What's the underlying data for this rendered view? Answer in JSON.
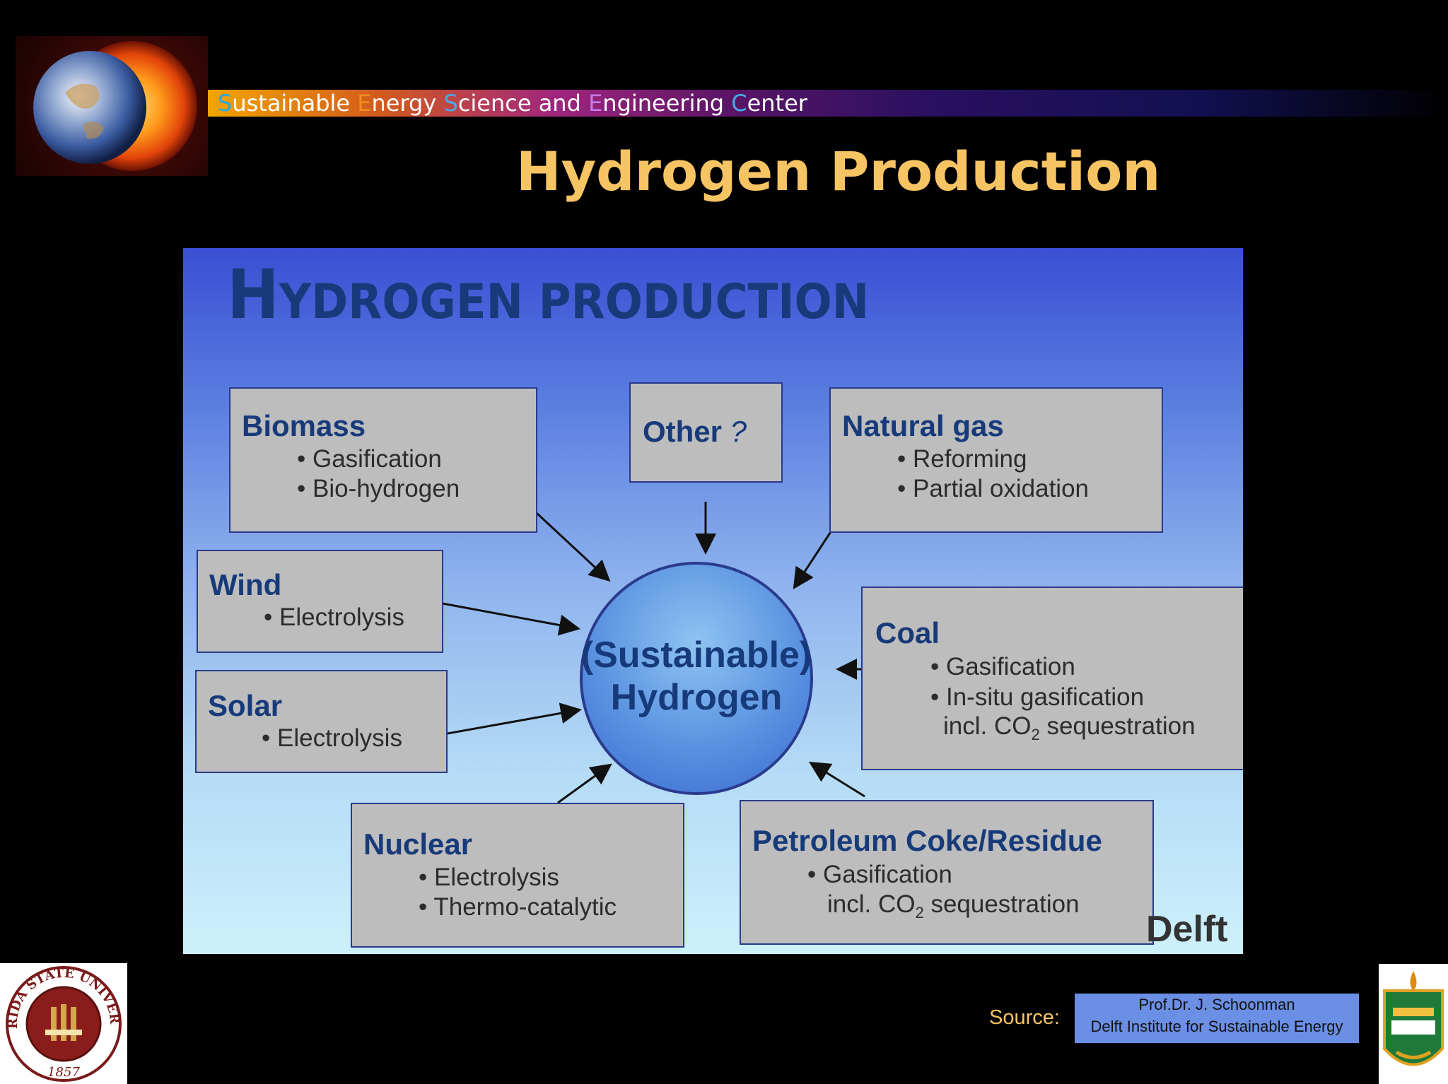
{
  "header": {
    "center_name_parts": [
      {
        "initial": "S",
        "rest": "ustainable ",
        "color": "#27a8e0"
      },
      {
        "initial": "E",
        "rest": "nergy ",
        "color": "#f28c20"
      },
      {
        "initial": "S",
        "rest": "cience and ",
        "color": "#4aa8e8"
      },
      {
        "initial": "E",
        "rest": "ngineering ",
        "color": "#c77be8"
      },
      {
        "initial": "C",
        "rest": "enter",
        "color": "#4aa8e8"
      }
    ],
    "slide_title": "Hydrogen Production"
  },
  "figure": {
    "title_cap": "H",
    "title_rest": "YDROGEN PRODUCTION",
    "watermark": "Delft",
    "hub": {
      "line1": "(Sustainable)",
      "line2": "Hydrogen"
    },
    "sources": {
      "biomass": {
        "name": "Biomass",
        "items": [
          "• Gasification",
          "• Bio-hydrogen"
        ]
      },
      "other": {
        "name": "Other",
        "suffix": " ?"
      },
      "natural_gas": {
        "name": "Natural gas",
        "items": [
          "• Reforming",
          "• Partial oxidation"
        ]
      },
      "wind": {
        "name": "Wind",
        "items": [
          "• Electrolysis"
        ]
      },
      "coal": {
        "name": "Coal",
        "items": [
          "• Gasification",
          "• In-situ gasification"
        ],
        "co2_prefix": "incl. CO",
        "co2_sub": "2",
        "co2_suffix": " sequestration"
      },
      "solar": {
        "name": "Solar",
        "items": [
          "• Electrolysis"
        ]
      },
      "nuclear": {
        "name": "Nuclear",
        "items": [
          "• Electrolysis",
          "• Thermo-catalytic"
        ]
      },
      "petroleum": {
        "name": "Petroleum Coke/Residue",
        "items": [
          "• Gasification"
        ],
        "co2_prefix": "incl. CO",
        "co2_sub": "2",
        "co2_suffix": " sequestration"
      }
    }
  },
  "footer": {
    "source_label": "Source:",
    "source_line1": "Prof.Dr. J. Schoonman",
    "source_line2": "Delft Institute for Sustainable Energy",
    "fsu_seal_text": {
      "top": "FLORIDA STATE UNIVERSITY",
      "year": "1857"
    }
  },
  "colors": {
    "title": "#f7c463",
    "figure_text": "#173a7a",
    "box_fill": "#bdbdbd",
    "box_border": "#2a3a8c"
  }
}
